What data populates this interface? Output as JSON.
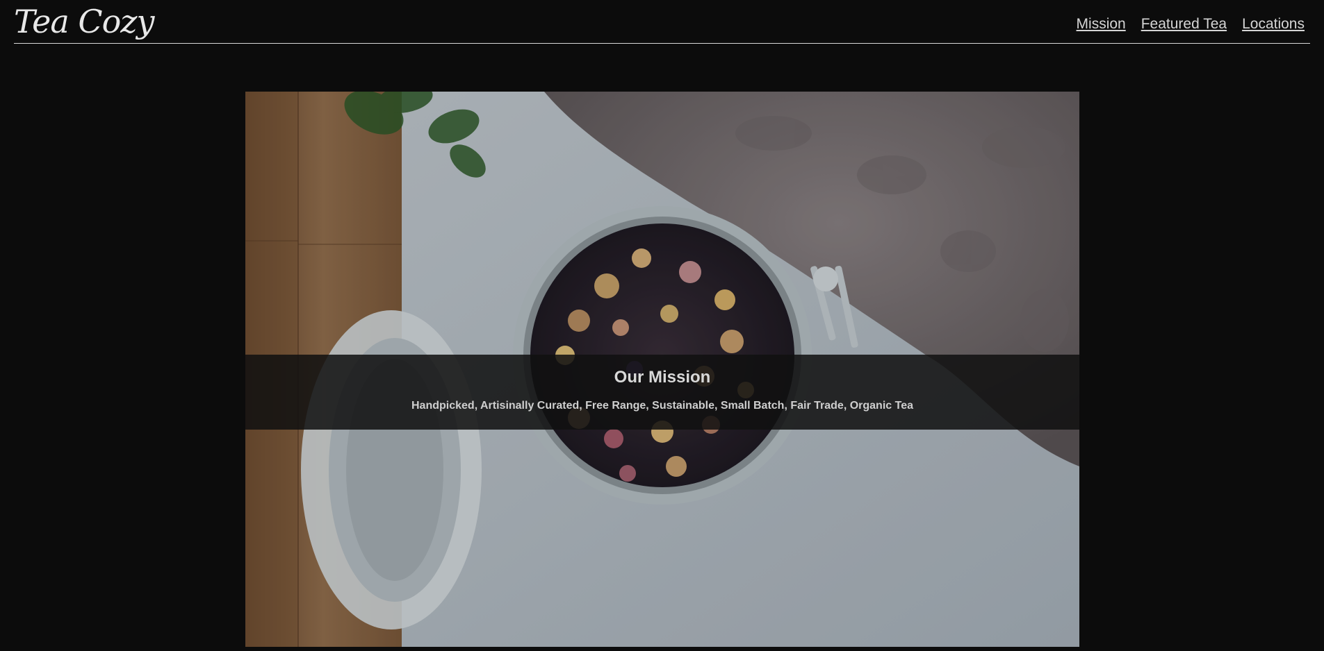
{
  "header": {
    "logo_text": "Tea Cozy",
    "nav": [
      {
        "label": "Mission"
      },
      {
        "label": "Featured Tea"
      },
      {
        "label": "Locations"
      }
    ]
  },
  "hero": {
    "title": "Our Mission",
    "subtitle": "Handpicked, Artisinally Curated, Free Range, Sustainable, Small Batch, Fair Trade, Organic Tea"
  },
  "colors": {
    "background": "#0c0c0c",
    "text": "#d9d9d9",
    "caption_bg": "rgba(16,16,16,0.86)"
  }
}
